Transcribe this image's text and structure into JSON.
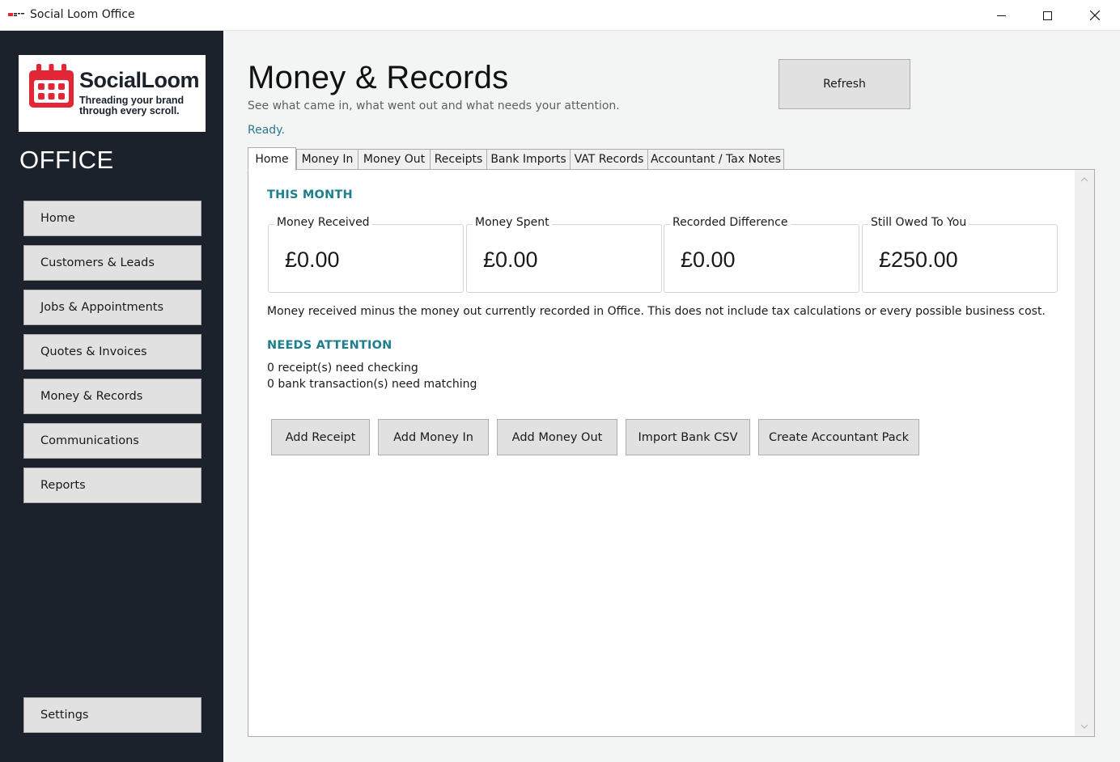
{
  "window": {
    "title": "Social Loom Office",
    "controls": [
      "minimize-icon",
      "maximize-icon",
      "close-icon"
    ]
  },
  "sidebar": {
    "logo": {
      "name": "SocialLoom",
      "tagline": "Threading your brand through every scroll.",
      "icon": "calendar-icon",
      "brand_color": "#e32636",
      "text_color": "#1b222c"
    },
    "section_label": "OFFICE",
    "items": [
      {
        "label": "Home"
      },
      {
        "label": "Customers & Leads"
      },
      {
        "label": "Jobs & Appointments"
      },
      {
        "label": "Quotes & Invoices"
      },
      {
        "label": "Money & Records"
      },
      {
        "label": "Communications"
      },
      {
        "label": "Reports"
      }
    ],
    "settings_label": "Settings",
    "background": "#1b222c"
  },
  "header": {
    "title": "Money & Records",
    "subtitle": "See what came in, what went out and what needs your attention.",
    "status": "Ready.",
    "refresh_label": "Refresh",
    "accent": "#1d7f8e"
  },
  "tabs": [
    {
      "label": "Home",
      "active": true
    },
    {
      "label": "Money In",
      "active": false
    },
    {
      "label": "Money Out",
      "active": false
    },
    {
      "label": "Receipts",
      "active": false
    },
    {
      "label": "Bank Imports",
      "active": false
    },
    {
      "label": "VAT Records",
      "active": false
    },
    {
      "label": "Accountant / Tax Notes",
      "active": false
    }
  ],
  "home": {
    "this_month_heading": "THIS MONTH",
    "metrics": [
      {
        "label": "Money Received",
        "value": "£0.00"
      },
      {
        "label": "Money Spent",
        "value": "£0.00"
      },
      {
        "label": "Recorded Difference",
        "value": "£0.00"
      },
      {
        "label": "Still Owed To You",
        "value": "£250.00"
      }
    ],
    "difference_note": "Money received minus the money out currently recorded in Office. This does not include tax calculations or every possible business cost.",
    "needs_attention_heading": "NEEDS ATTENTION",
    "attention_items": [
      "0 receipt(s) need checking",
      "0 bank transaction(s) need matching"
    ],
    "actions": [
      {
        "label": "Add Receipt"
      },
      {
        "label": "Add Money In"
      },
      {
        "label": "Add Money Out"
      },
      {
        "label": "Import Bank CSV"
      },
      {
        "label": "Create Accountant Pack"
      }
    ]
  }
}
